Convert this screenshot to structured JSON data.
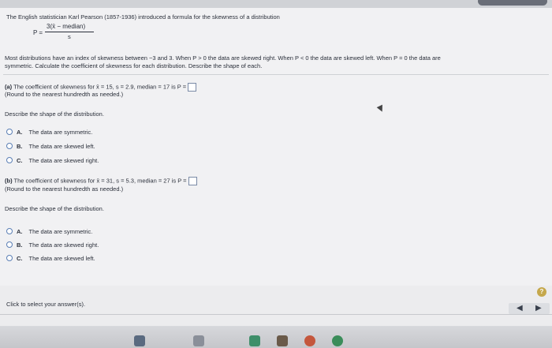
{
  "problem": {
    "intro": "The English statistician Karl Pearson (1857-1936) introduced a formula for the skewness of a distribution",
    "formula": {
      "lhs": "P =",
      "numerator": "3(x̄ − median)",
      "denominator": "s"
    },
    "description_line1": "Most distributions have an index of skewness between  −3 and 3. When P > 0 the data are skewed right. When P < 0 the data are skewed left. When P = 0 the data are",
    "description_line2": "symmetric. Calculate the coefficient of skewness for each distribution. Describe the shape of each."
  },
  "part_a": {
    "label": "(a)",
    "prompt": "The coefficient of skewness for x̄ = 15, s = 2.9, median = 17 is P =",
    "rounding": "(Round to the nearest hundredth as needed.)",
    "shape_prompt": "Describe the shape of the distribution.",
    "options": [
      {
        "key": "A.",
        "text": "The data are symmetric."
      },
      {
        "key": "B.",
        "text": "The data are skewed left."
      },
      {
        "key": "C.",
        "text": "The data are skewed right."
      }
    ]
  },
  "part_b": {
    "label": "(b)",
    "prompt": "The coefficient of skewness for x̄ = 31, s = 5.3, median = 27 is P =",
    "rounding": "(Round to the nearest hundredth as needed.)",
    "shape_prompt": "Describe the shape of the distribution.",
    "options": [
      {
        "key": "A.",
        "text": "The data are symmetric."
      },
      {
        "key": "B.",
        "text": "The data are skewed right."
      },
      {
        "key": "C.",
        "text": "The data are skewed left."
      }
    ]
  },
  "footer": {
    "hint": "Click to select your answer(s).",
    "help_symbol": "?",
    "prev_symbol": "◀",
    "next_symbol": "▶"
  },
  "colors": {
    "radio_border": "#5b7fb5",
    "help_badge": "#c5a84c"
  }
}
